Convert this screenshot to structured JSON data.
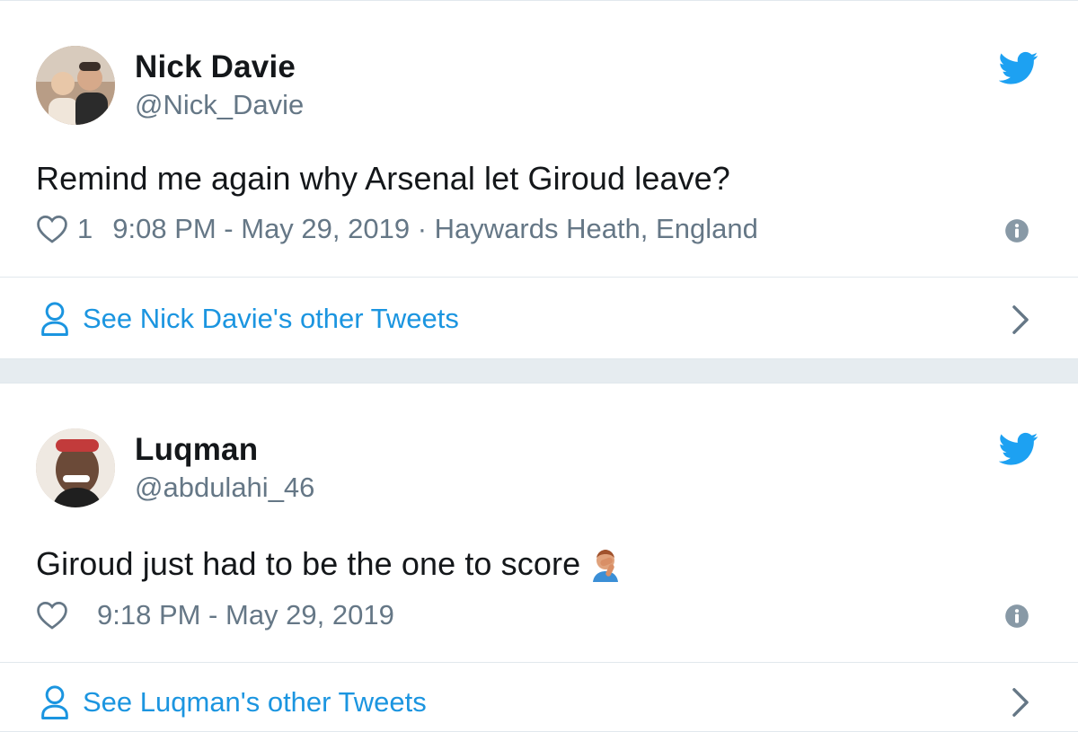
{
  "tweets": [
    {
      "name": "Nick Davie",
      "handle": "@Nick_Davie",
      "text": "Remind me again why Arsenal let Giroud leave?",
      "likes": "1",
      "timestamp": "9:08 PM - May 29, 2019",
      "location_sep": " · ",
      "location": "Haywards Heath, England",
      "see_more": "See Nick Davie's other Tweets"
    },
    {
      "name": "Luqman",
      "handle": "@abdulahi_46",
      "text": "Giroud just had to be the one to score",
      "emoji": "facepalm",
      "likes": "",
      "timestamp": "9:18 PM - May 29, 2019",
      "see_more": "See Luqman's other Tweets"
    }
  ],
  "colors": {
    "accent": "#1da1f2",
    "link": "#1b95e0",
    "muted": "#657786",
    "text": "#14171a",
    "border": "#e1e8ed",
    "background": "#e6ecf0"
  },
  "icons": [
    "twitter-bird-icon",
    "heart-icon",
    "info-icon",
    "person-icon",
    "chevron-right-icon"
  ]
}
